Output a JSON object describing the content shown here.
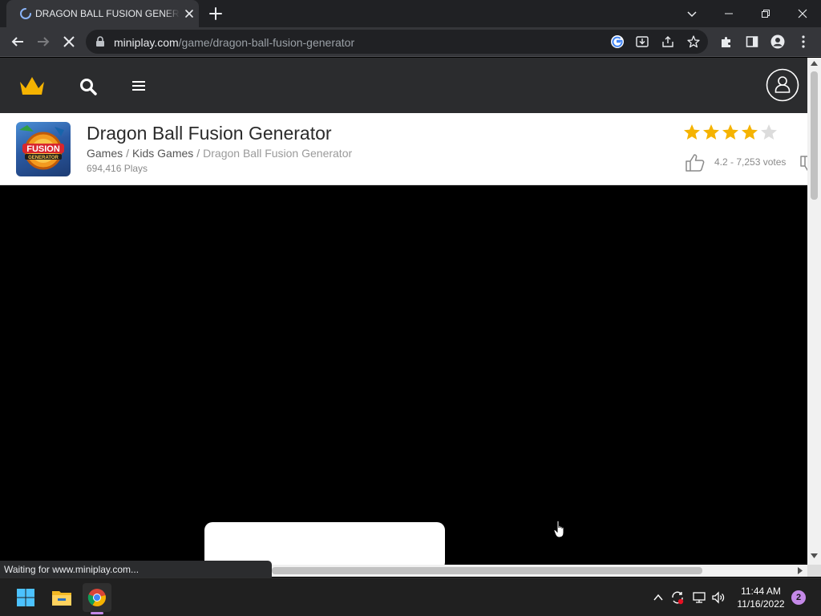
{
  "browser": {
    "tab": {
      "title": "DRAGON BALL FUSION GENERATOR",
      "icon": "loading-spinner-icon"
    },
    "address": {
      "host": "miniplay.com",
      "path": "/game/dragon-ball-fusion-generator"
    },
    "status": "Waiting for www.miniplay.com..."
  },
  "site": {
    "logo": "crown-icon",
    "accent_color": "#f5b301"
  },
  "game": {
    "title": "Dragon Ball Fusion Generator",
    "breadcrumbs": [
      "Games",
      "Kids Games",
      "Dragon Ball Fusion Generator"
    ],
    "plays": "694,416 Plays",
    "rating": 4.2,
    "rating_text": "4.2 - 7,253 votes",
    "thumbnail_text": {
      "top": "FUSION",
      "bottom": "GENERATOR"
    }
  },
  "taskbar": {
    "time": "11:44 AM",
    "date": "11/16/2022",
    "notifications": "2"
  }
}
